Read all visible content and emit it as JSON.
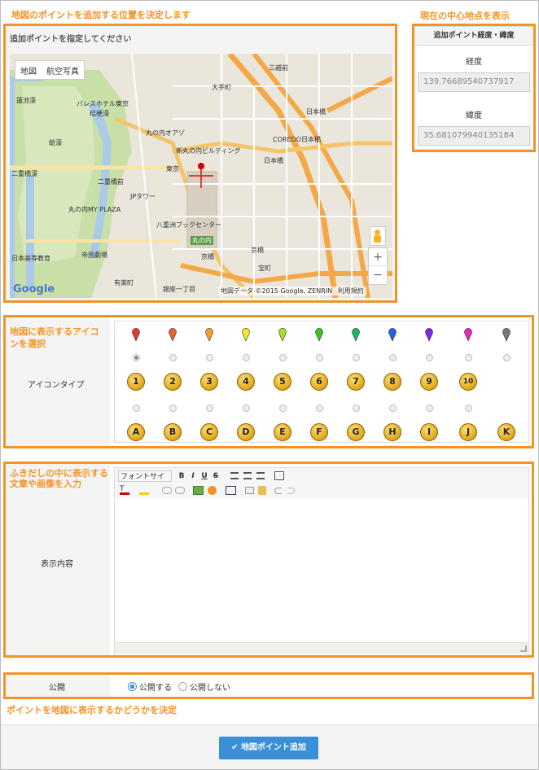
{
  "annotations": {
    "map_position": "地図のポイントを追加する位置を決定します",
    "center_point": "現在の中心地点を表示",
    "icon_select": "地図に表示するアイコンを選択",
    "balloon_content": "ふきだしの中に表示する文章や画像を入力",
    "visibility": "ポイントを地図に表示するかどうかを決定"
  },
  "map_panel": {
    "title": "追加ポイントを指定してください",
    "type_map": "地図",
    "type_aerial": "航空写真",
    "zoom_in": "+",
    "zoom_out": "−",
    "attribution": "地図データ ©2015 Google, ZENRIN",
    "terms": "利用規約",
    "logo": "Google",
    "labels": [
      "三越前",
      "日本橋",
      "大手町",
      "丸の内オアゾ",
      "新丸の内ビルディング",
      "東京",
      "COREDO日本橋",
      "二重橋前",
      "JPタワー",
      "丸の内MY PLAZA",
      "日本橋",
      "京橋",
      "八重洲ブックセンター",
      "丸の内",
      "宝町",
      "京橋",
      "有楽町",
      "銀座一丁目",
      "蓮池濠",
      "パレスホテル東京",
      "桔梗濠",
      "蛤濠",
      "二重橋濠",
      "帝国劇場",
      "日本高等教育"
    ]
  },
  "coords": {
    "title": "追加ポイント経度・緯度",
    "lng_label": "経度",
    "lng_value": "139.76689540737917",
    "lat_label": "緯度",
    "lat_value": "35.681079940135184"
  },
  "icons": {
    "label": "アイコンタイプ",
    "pin_colors": [
      "#e53535",
      "#f0602a",
      "#f5a020",
      "#f2e62a",
      "#a6e22a",
      "#38c41e",
      "#1fb85a",
      "#2a5ee8",
      "#7a2ae8",
      "#e82ab2",
      "#777777"
    ],
    "numbers": [
      "1",
      "2",
      "3",
      "4",
      "5",
      "6",
      "7",
      "8",
      "9",
      "10"
    ],
    "letters": [
      "A",
      "B",
      "C",
      "D",
      "E",
      "F",
      "G",
      "H",
      "I",
      "J",
      "K"
    ],
    "selected_index": 0
  },
  "content": {
    "label": "表示内容",
    "font_size_label": "フォントサイ",
    "bold": "B",
    "italic": "I",
    "underline": "U",
    "strike": "S"
  },
  "publish": {
    "label": "公開",
    "option_on": "公開する",
    "option_off": "公開しない",
    "selected": "on"
  },
  "submit": {
    "label": "地図ポイント追加"
  },
  "colors": {
    "accent": "#f39326",
    "button": "#3a8fd6"
  }
}
